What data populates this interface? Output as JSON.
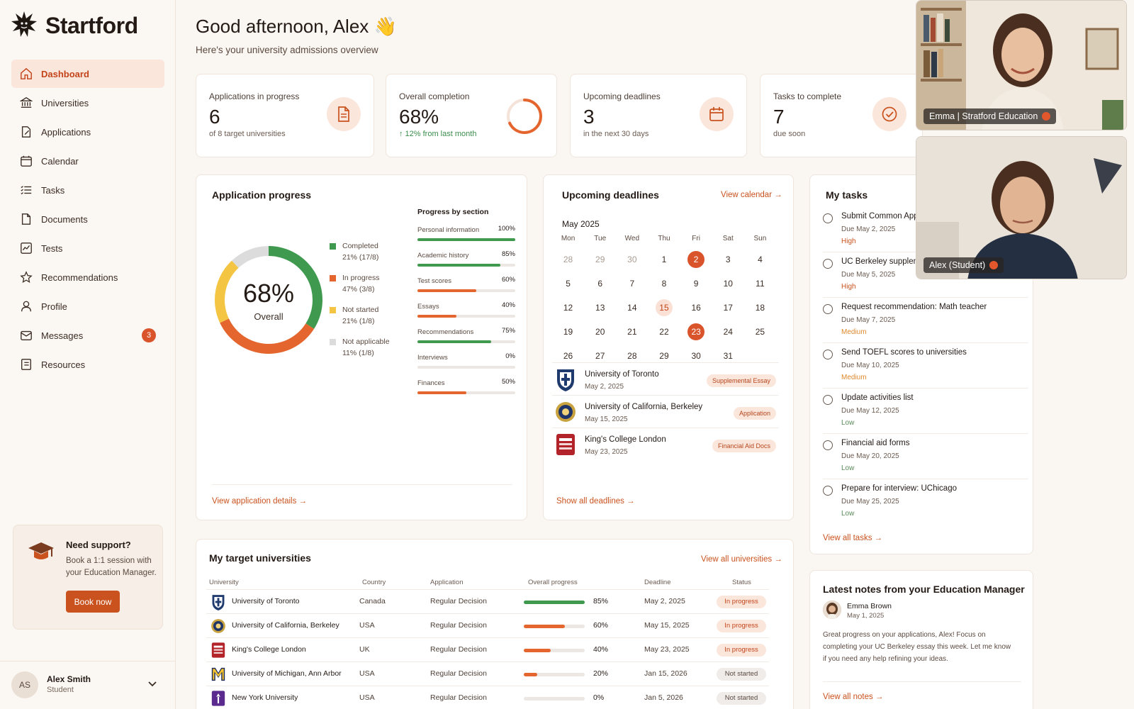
{
  "brand": {
    "name": "Startford"
  },
  "nav": [
    {
      "label": "Dashboard",
      "icon": "home-icon",
      "active": true
    },
    {
      "label": "Universities",
      "icon": "bank-icon"
    },
    {
      "label": "Applications",
      "icon": "edit-document-icon"
    },
    {
      "label": "Calendar",
      "icon": "calendar-icon"
    },
    {
      "label": "Tasks",
      "icon": "list-icon"
    },
    {
      "label": "Documents",
      "icon": "document-icon"
    },
    {
      "label": "Tests",
      "icon": "chart-icon"
    },
    {
      "label": "Recommendations",
      "icon": "star-icon"
    },
    {
      "label": "Profile",
      "icon": "user-icon"
    },
    {
      "label": "Messages",
      "icon": "mail-icon",
      "badge": "3"
    },
    {
      "label": "Resources",
      "icon": "book-icon"
    }
  ],
  "support": {
    "title": "Need support?",
    "text": "Book a 1:1 session with your Education Manager.",
    "button": "Book now"
  },
  "user": {
    "initials": "AS",
    "name": "Alex Smith",
    "role": "Student"
  },
  "header": {
    "greeting": "Good afternoon, Alex 👋",
    "subtitle": "Here's your university admissions overview"
  },
  "stats": [
    {
      "label": "Applications in progress",
      "value": "6",
      "sub": "of 8 target universities",
      "icon": "document-icon"
    },
    {
      "label": "Overall completion",
      "value": "68%",
      "sub": "↑ 12% from last month",
      "progress": 0.68
    },
    {
      "label": "Upcoming deadlines",
      "value": "3",
      "sub": "in the next 30 days",
      "icon": "calendar-icon"
    },
    {
      "label": "Tasks to complete",
      "value": "7",
      "sub": "due soon",
      "icon": "check-circle-icon"
    }
  ],
  "app_progress": {
    "title": "Application progress",
    "center_value": "68%",
    "center_label": "Overall",
    "link": "View application details",
    "legend": [
      {
        "label": "Completed",
        "detail": "21% (17/8)",
        "color": "#3f9a4f",
        "share": 0.21
      },
      {
        "label": "In progress",
        "detail": "47% (3/8)",
        "color": "#e4662e",
        "share": 0.47
      },
      {
        "label": "Not started",
        "detail": "21% (1/8)",
        "color": "#f4c542",
        "share": 0.21
      },
      {
        "label": "Not applicable",
        "detail": "11% (1/8)",
        "color": "#dcdcdc",
        "share": 0.11
      }
    ],
    "donut_segments": [
      {
        "color": "#3f9a4f",
        "share": 0.34
      },
      {
        "color": "#e4662e",
        "share": 0.34
      },
      {
        "color": "#f4c542",
        "share": 0.2
      },
      {
        "color": "#dcdcdc",
        "share": 0.12
      }
    ],
    "sections_title": "Progress by section",
    "sections": [
      {
        "label": "Personal information",
        "pct": "100%",
        "value": 1.0,
        "color": "#3f9a4f"
      },
      {
        "label": "Academic history",
        "pct": "85%",
        "value": 0.85,
        "color": "#3f9a4f"
      },
      {
        "label": "Test scores",
        "pct": "60%",
        "value": 0.6,
        "color": "#e4662e"
      },
      {
        "label": "Essays",
        "pct": "40%",
        "value": 0.4,
        "color": "#e4662e"
      },
      {
        "label": "Recommendations",
        "pct": "75%",
        "value": 0.75,
        "color": "#3f9a4f"
      },
      {
        "label": "Interviews",
        "pct": "0%",
        "value": 0.0,
        "color": "#e4662e"
      },
      {
        "label": "Finances",
        "pct": "50%",
        "value": 0.5,
        "color": "#e4662e"
      }
    ]
  },
  "deadlines": {
    "title": "Upcoming deadlines",
    "link": "View calendar",
    "month": "May 2025",
    "weekdays": [
      "Mon",
      "Tue",
      "Wed",
      "Thu",
      "Fri",
      "Sat",
      "Sun"
    ],
    "days": [
      {
        "d": "28",
        "m": true
      },
      {
        "d": "29",
        "m": true
      },
      {
        "d": "30",
        "m": true
      },
      {
        "d": "1"
      },
      {
        "d": "2",
        "hl": true
      },
      {
        "d": "3"
      },
      {
        "d": "4"
      },
      {
        "d": "5"
      },
      {
        "d": "6"
      },
      {
        "d": "7"
      },
      {
        "d": "8"
      },
      {
        "d": "9"
      },
      {
        "d": "10"
      },
      {
        "d": "11"
      },
      {
        "d": "12"
      },
      {
        "d": "13"
      },
      {
        "d": "14"
      },
      {
        "d": "15",
        "soft": true
      },
      {
        "d": "16"
      },
      {
        "d": "17"
      },
      {
        "d": "18"
      },
      {
        "d": "19"
      },
      {
        "d": "20"
      },
      {
        "d": "21"
      },
      {
        "d": "22"
      },
      {
        "d": "23",
        "hl": true
      },
      {
        "d": "24"
      },
      {
        "d": "25"
      },
      {
        "d": "26"
      },
      {
        "d": "27"
      },
      {
        "d": "28"
      },
      {
        "d": "29"
      },
      {
        "d": "30"
      },
      {
        "d": "31"
      },
      {
        "d": ""
      }
    ],
    "items": [
      {
        "name": "University of Toronto",
        "date": "May 2, 2025",
        "tag": "Supplemental Essay",
        "logo": "toronto-crest-icon"
      },
      {
        "name": "University of California, Berkeley",
        "date": "May 15, 2025",
        "tag": "Application",
        "logo": "berkeley-seal-icon"
      },
      {
        "name": "King's College London",
        "date": "May 23, 2025",
        "tag": "Financial Aid Docs",
        "logo": "kings-crest-icon"
      }
    ],
    "show_all": "Show all deadlines"
  },
  "tasks": {
    "title": "My tasks",
    "items": [
      {
        "name": "Submit Common App",
        "due": "Due May 2, 2025",
        "priority": "High",
        "level": "high"
      },
      {
        "name": "UC Berkeley suppleme",
        "due": "Due May 5, 2025",
        "priority": "High",
        "level": "high"
      },
      {
        "name": "Request recommendation: Math teacher",
        "due": "Due May 7, 2025",
        "priority": "Medium",
        "level": "medium"
      },
      {
        "name": "Send TOEFL scores to universities",
        "due": "Due May 10, 2025",
        "priority": "Medium",
        "level": "medium"
      },
      {
        "name": "Update activities list",
        "due": "Due May 12, 2025",
        "priority": "Low",
        "level": "low"
      },
      {
        "name": "Financial aid forms",
        "due": "Due May 20, 2025",
        "priority": "Low",
        "level": "low"
      },
      {
        "name": "Prepare for interview: UChicago",
        "due": "Due May 25, 2025",
        "priority": "Low",
        "level": "low"
      }
    ],
    "link": "View all tasks"
  },
  "universities": {
    "title": "My target universities",
    "link": "View all universities",
    "columns": [
      "University",
      "Country",
      "Application",
      "Overall progress",
      "Deadline",
      "Status"
    ],
    "rows": [
      {
        "name": "University of Toronto",
        "country": "Canada",
        "app": "Regular Decision",
        "progress": 1.0,
        "pct": "85%",
        "deadline": "May 2, 2025",
        "status": "In progress",
        "sclass": "prog",
        "color": "#3f9a4f",
        "logo": "toronto-crest-icon"
      },
      {
        "name": "University of California, Berkeley",
        "country": "USA",
        "app": "Regular Decision",
        "progress": 0.68,
        "pct": "60%",
        "deadline": "May 15, 2025",
        "status": "In progress",
        "sclass": "prog",
        "color": "#e4662e",
        "logo": "berkeley-seal-icon"
      },
      {
        "name": "King's College London",
        "country": "UK",
        "app": "Regular Decision",
        "progress": 0.44,
        "pct": "40%",
        "deadline": "May 23, 2025",
        "status": "In progress",
        "sclass": "prog",
        "color": "#e4662e",
        "logo": "kings-crest-icon"
      },
      {
        "name": "University of Michigan, Ann Arbor",
        "country": "USA",
        "app": "Regular Decision",
        "progress": 0.22,
        "pct": "20%",
        "deadline": "Jan 15, 2026",
        "status": "Not started",
        "sclass": "none",
        "color": "#e4662e",
        "logo": "michigan-m-icon"
      },
      {
        "name": "New York University",
        "country": "USA",
        "app": "Regular Decision",
        "progress": 0.0,
        "pct": "0%",
        "deadline": "Jan 5, 2026",
        "status": "Not started",
        "sclass": "none",
        "color": "#e4662e",
        "logo": "nyu-torch-icon"
      }
    ]
  },
  "notes": {
    "title": "Latest notes from your Education Manager",
    "author": "Emma Brown",
    "date": "May 1, 2025",
    "body": "Great progress on your applications, Alex! Focus on completing your UC Berkeley essay this week. Let me know if you need any help refining your ideas.",
    "link": "View all notes"
  },
  "video": {
    "tile1": "Emma | Stratford Education",
    "tile2": "Alex (Student)"
  }
}
